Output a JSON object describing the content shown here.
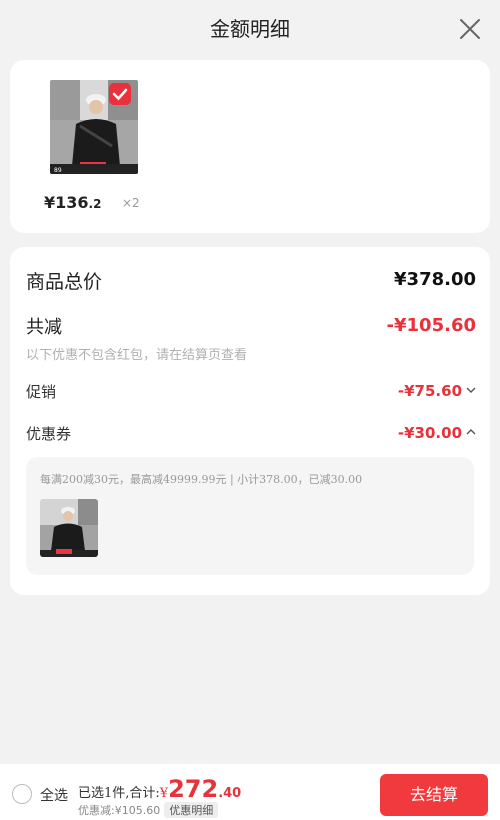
{
  "header": {
    "title": "金额明细"
  },
  "product": {
    "price_main": "¥136",
    "price_decimal": ".2",
    "quantity": "×2",
    "image_badge_text": "专属折扣"
  },
  "summary": {
    "total_label": "商品总价",
    "total_value": "¥378.00",
    "discount_label": "共减",
    "discount_value": "-¥105.60",
    "note": "以下优惠不包含红包，请在结算页查看",
    "promo_label": "促销",
    "promo_value": "-¥75.60",
    "coupon_label": "优惠券",
    "coupon_value": "-¥30.00",
    "coupon_desc": "每满200减30元，最高减49999.99元 | 小计378.00，已减30.00"
  },
  "bottom": {
    "select_all": "全选",
    "selected_text": "已选1件,合计:",
    "currency": "¥",
    "total_main": "272",
    "total_decimal": ".40",
    "saved_text": "优惠减:¥105.60",
    "detail_chip": "优惠明细",
    "checkout_label": "去结算"
  },
  "colors": {
    "accent": "#e8313a",
    "checkout": "#f03a3d"
  },
  "icons": {
    "close": "close-icon",
    "check": "check-icon",
    "chevron_down": "chevron-down-icon",
    "chevron_up": "chevron-up-icon",
    "radio": "radio-icon"
  }
}
